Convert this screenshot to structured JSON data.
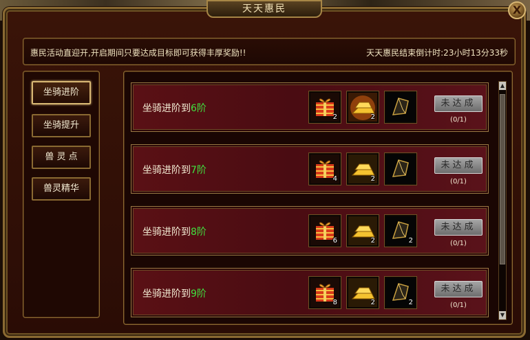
{
  "window": {
    "title": "天天惠民",
    "close_label": "X"
  },
  "notice": {
    "text": "惠民活动直迎开,开启期间只要达成目标即可获得丰厚奖励!!",
    "countdown": "天天惠民结束倒计时:23小时13分33秒"
  },
  "tabs": [
    {
      "label": "坐骑进阶",
      "active": true
    },
    {
      "label": "坐骑提升",
      "active": false
    },
    {
      "label": "兽 灵 点",
      "active": false
    },
    {
      "label": "兽灵精华",
      "active": false
    }
  ],
  "rows": [
    {
      "prefix": "坐骑进阶到",
      "level": "6阶",
      "items": [
        {
          "icon": "gift-box-icon",
          "count": "2"
        },
        {
          "icon": "gold-bars-icon",
          "count": "2"
        },
        {
          "icon": "dark-crystal-icon",
          "count": ""
        }
      ],
      "button": "未达成",
      "progress": "(0/1)"
    },
    {
      "prefix": "坐骑进阶到",
      "level": "7阶",
      "items": [
        {
          "icon": "gift-box-icon",
          "count": "4"
        },
        {
          "icon": "gold-bars-icon",
          "count": "2"
        },
        {
          "icon": "dark-crystal-icon",
          "count": ""
        }
      ],
      "button": "未达成",
      "progress": "(0/1)"
    },
    {
      "prefix": "坐骑进阶到",
      "level": "8阶",
      "items": [
        {
          "icon": "gift-box-icon",
          "count": "6"
        },
        {
          "icon": "gold-bars-icon",
          "count": "2"
        },
        {
          "icon": "dark-crystal-icon",
          "count": "2"
        }
      ],
      "button": "未达成",
      "progress": "(0/1)"
    },
    {
      "prefix": "坐骑进阶到",
      "level": "9阶",
      "items": [
        {
          "icon": "gift-box-icon",
          "count": "8"
        },
        {
          "icon": "gold-bars-icon",
          "count": "2"
        },
        {
          "icon": "dark-crystal-icon",
          "count": "2"
        }
      ],
      "button": "未达成",
      "progress": "(0/1)"
    }
  ],
  "scrollbar": {
    "up": "▲",
    "down": "▼"
  },
  "colors": {
    "accent_gold": "#d9b874",
    "level_green": "#40e040",
    "row_red": "#5a1015"
  }
}
